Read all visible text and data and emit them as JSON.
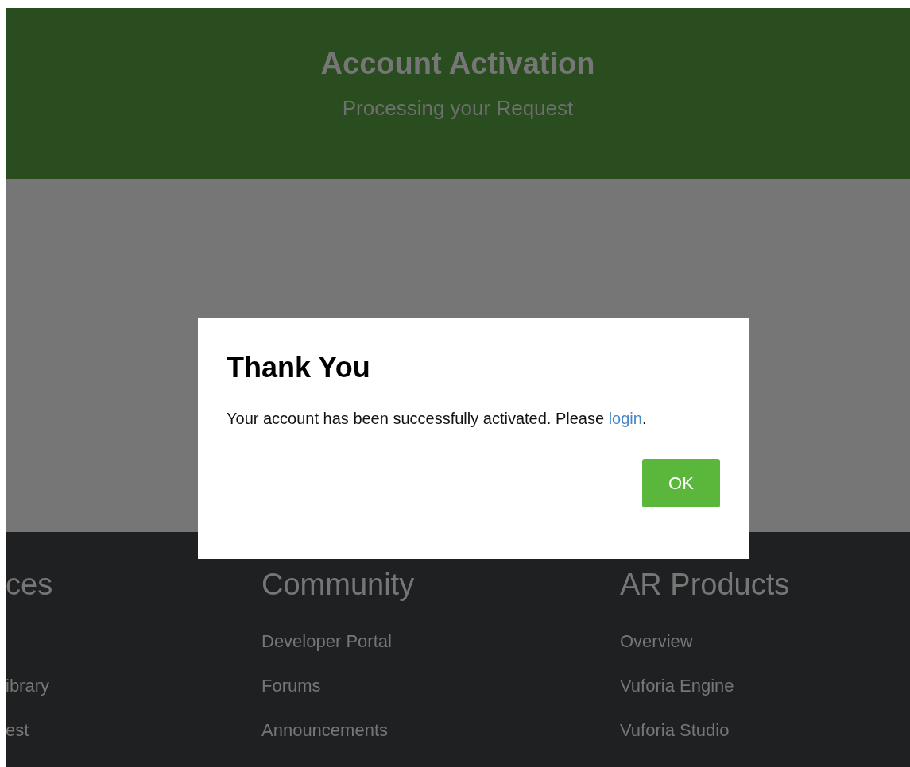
{
  "header": {
    "title": "Account Activation",
    "subtitle": "Processing your Request"
  },
  "footer": {
    "columns": [
      {
        "heading": "ces",
        "links": [
          {
            "blank": true
          },
          {
            "label": "ibrary"
          },
          {
            "label": "est"
          }
        ]
      },
      {
        "heading": "Community",
        "links": [
          {
            "label": "Developer Portal"
          },
          {
            "label": "Forums"
          },
          {
            "label": "Announcements"
          }
        ]
      },
      {
        "heading": "AR Products",
        "links": [
          {
            "label": "Overview"
          },
          {
            "label": "Vuforia Engine"
          },
          {
            "label": "Vuforia Studio"
          }
        ]
      }
    ]
  },
  "dialog": {
    "title": "Thank You",
    "message": "Your account has been successfully activated. Please ",
    "link": "login",
    "message_end": ".",
    "button": "OK"
  }
}
